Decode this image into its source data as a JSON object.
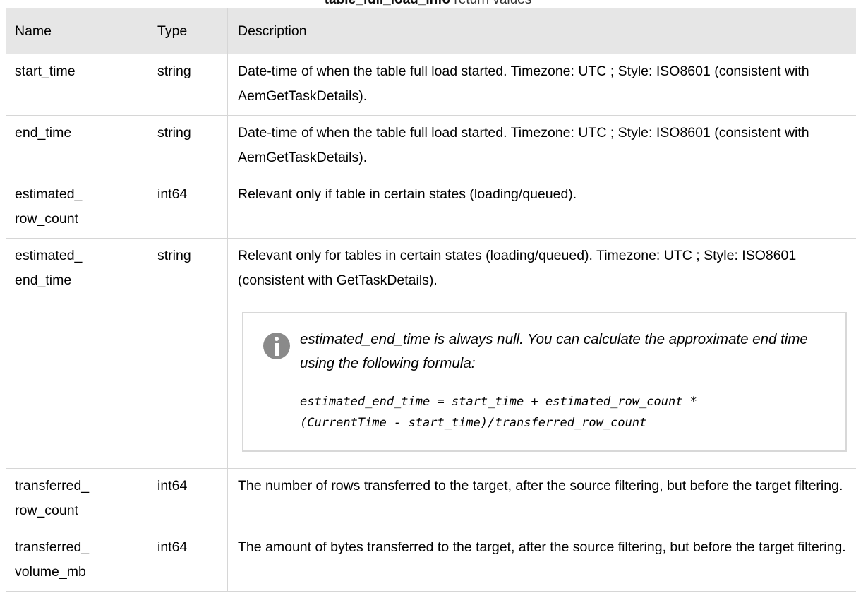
{
  "caption": {
    "code": "table_full_load_info",
    "rest": " return values"
  },
  "table": {
    "headers": {
      "name": "Name",
      "type": "Type",
      "description": "Description"
    },
    "rows": [
      {
        "name": "start_time",
        "type": "string",
        "description": "Date-time of when the table full load started. Timezone: UTC ; Style: ISO8601 (consistent with AemGetTaskDetails)."
      },
      {
        "name": "end_time",
        "type": "string",
        "description": "Date-time of when the table full load started. Timezone: UTC ; Style: ISO8601 (consistent with AemGetTaskDetails)."
      },
      {
        "name": "estimated_ row_count",
        "type": "int64",
        "description": "Relevant only if table in certain states (loading/queued)."
      },
      {
        "name": "estimated_ end_time",
        "type": "string",
        "description": "Relevant only for tables in certain states (loading/queued). Timezone: UTC ; Style: ISO8601 (consistent with GetTaskDetails).",
        "note": {
          "text": "estimated_end_time is always null. You can calculate the approximate end time using the following formula:",
          "formula_line1": "estimated_end_time = start_time + estimated_row_count *",
          "formula_line2": "(CurrentTime - start_time)/transferred_row_count"
        }
      },
      {
        "name": "transferred_ row_count",
        "type": "int64",
        "description": "The number of rows transferred to the target, after the source filtering, but before the target filtering."
      },
      {
        "name": "transferred_ volume_mb",
        "type": "int64",
        "description": "The amount of bytes transferred to the target, after the source filtering, but before the target filtering."
      }
    ]
  },
  "icons": {
    "note_icon": "info-icon"
  },
  "colors": {
    "header_bg": "#e6e6e6",
    "border": "#d6d6d6",
    "icon": "#8a8a8a"
  }
}
